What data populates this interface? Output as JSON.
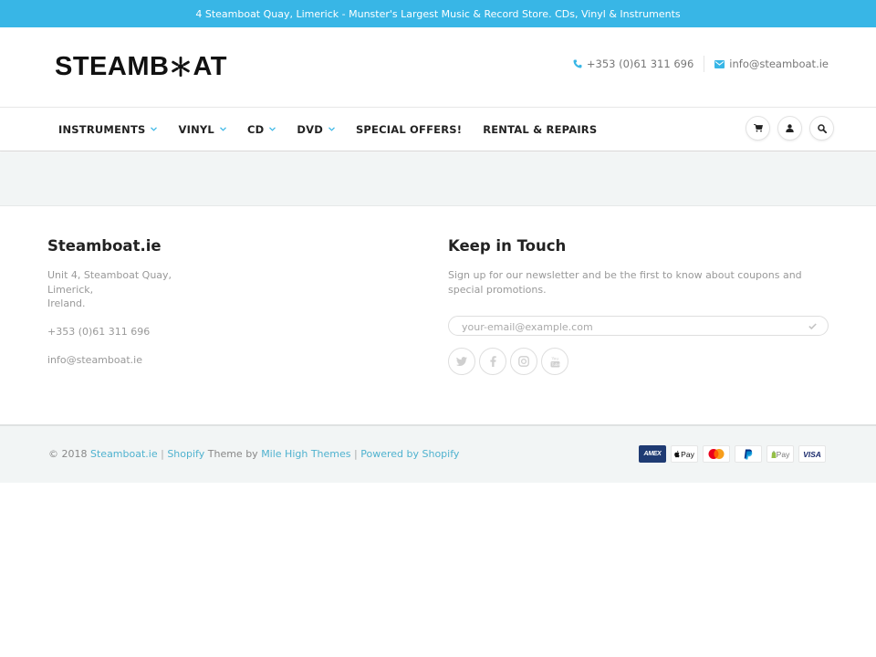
{
  "announcement": {
    "text": "4 Steamboat Quay, Limerick - Munster's Largest Music & Record Store. CDs, Vinyl & Instruments",
    "background": "#38b6e6"
  },
  "header": {
    "logo_left": "STEAMB",
    "logo_right": "AT",
    "logo_alt": "STEAMBOAT",
    "phone_icon": "phone-icon",
    "phone": "+353 (0)61 311 696",
    "email_icon": "envelope-icon",
    "email": "info@steamboat.ie"
  },
  "nav": {
    "items": [
      {
        "label": "INSTRUMENTS",
        "dropdown": true
      },
      {
        "label": "VINYL",
        "dropdown": true
      },
      {
        "label": "CD",
        "dropdown": true
      },
      {
        "label": "DVD",
        "dropdown": true
      },
      {
        "label": "SPECIAL OFFERS!",
        "dropdown": false
      },
      {
        "label": "RENTAL & REPAIRS",
        "dropdown": false
      }
    ],
    "icons": [
      "cart-icon",
      "user-icon",
      "search-icon"
    ],
    "accent": "#38b6e6"
  },
  "footer": {
    "about": {
      "title": "Steamboat.ie",
      "address_line1": "Unit 4, Steamboat Quay,",
      "address_line2": "Limerick,",
      "address_line3": "Ireland.",
      "phone": "+353 (0)61 311 696",
      "email": "info@steamboat.ie"
    },
    "newsletter": {
      "title": "Keep in Touch",
      "text": "Sign up for our newsletter and be the first to know about coupons and special promotions.",
      "email_placeholder": "your-email@example.com",
      "email_value": "",
      "submit_icon": "checkmark-icon",
      "socials": [
        "twitter-icon",
        "facebook-icon",
        "instagram-icon",
        "youtube-icon"
      ]
    },
    "bottom": {
      "copyright": "© 2018",
      "site_link": "Steamboat.ie",
      "sep": "|",
      "shopify_link": "Shopify",
      "theme_by": "Theme by",
      "theme_link": "Mile High Themes",
      "powered_link": "Powered by Shopify",
      "link_color": "#4fb2cf",
      "payments": [
        {
          "name": "amex",
          "label": "AMEX"
        },
        {
          "name": "apple-pay",
          "label": "Pay"
        },
        {
          "name": "mastercard",
          "label": ""
        },
        {
          "name": "paypal",
          "label": "P"
        },
        {
          "name": "google-pay",
          "label": "Pay"
        },
        {
          "name": "visa",
          "label": "VISA"
        }
      ]
    }
  }
}
